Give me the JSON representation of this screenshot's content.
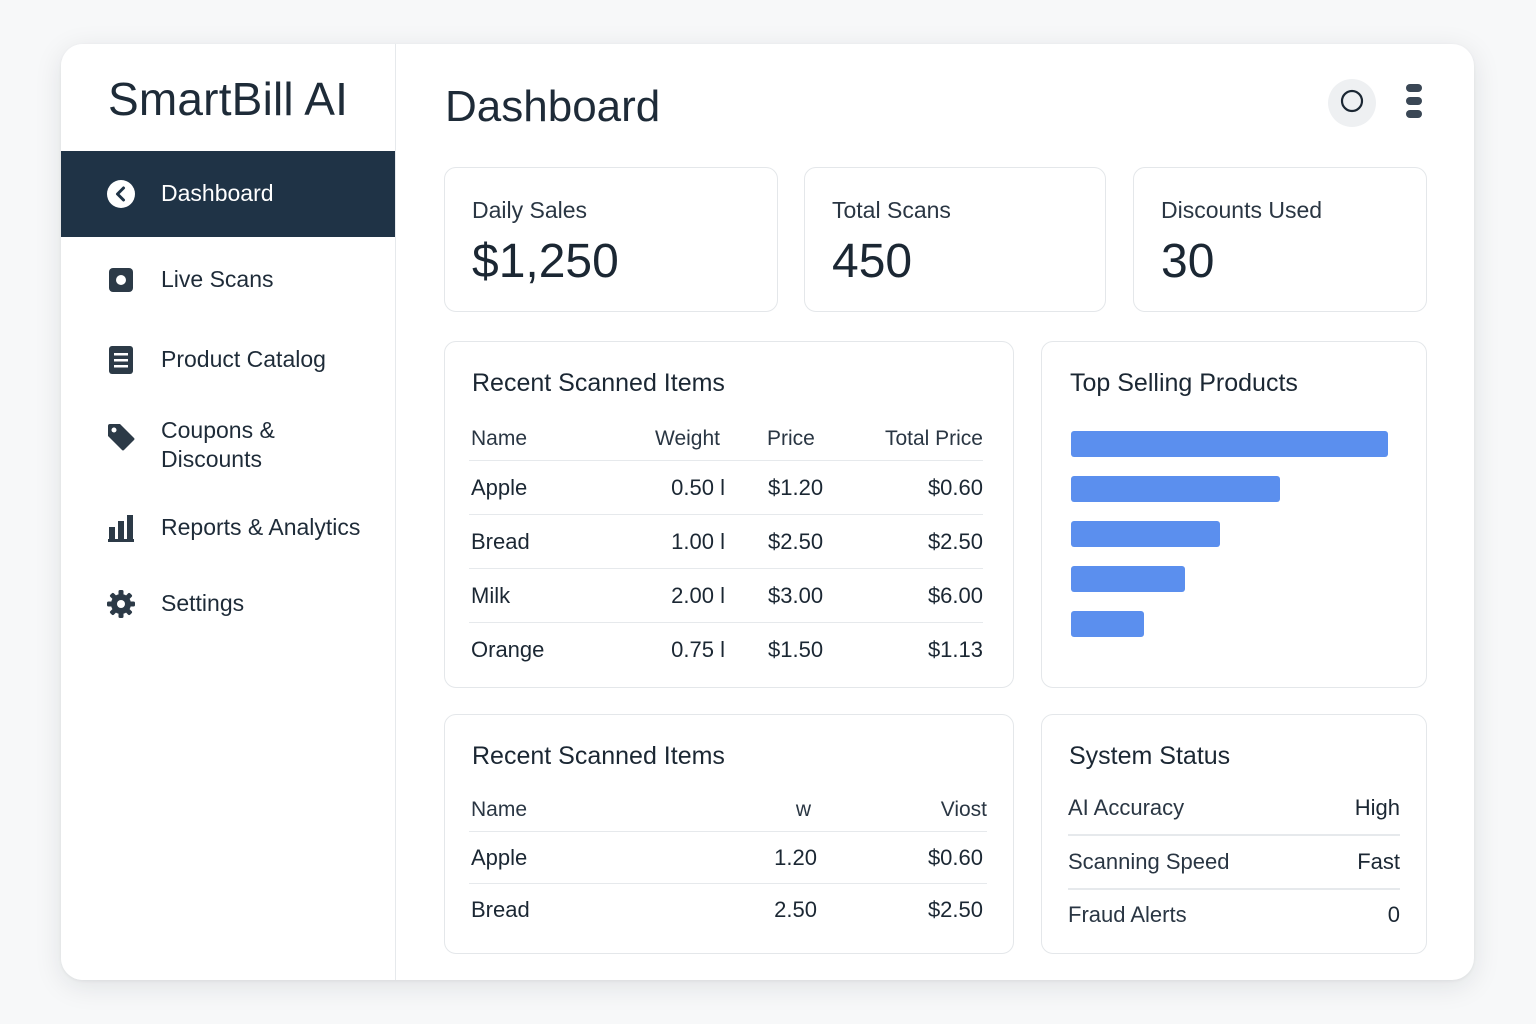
{
  "app": {
    "brand": "SmartBill AI"
  },
  "sidebar": {
    "items": [
      {
        "label": "Dashboard",
        "icon": "chevron-left-circle-icon",
        "active": true
      },
      {
        "label": "Live Scans",
        "icon": "scan-icon",
        "active": false
      },
      {
        "label": "Product Catalog",
        "icon": "document-list-icon",
        "active": false
      },
      {
        "label_line1": "Coupons &",
        "label_line2": "Discounts",
        "icon": "tag-icon",
        "active": false
      },
      {
        "label": "Reports & Analytics",
        "icon": "bar-chart-icon",
        "active": false
      },
      {
        "label": "Settings",
        "icon": "gear-icon",
        "active": false
      }
    ]
  },
  "header": {
    "title": "Dashboard",
    "icons": [
      "circle-icon",
      "menu-icon"
    ]
  },
  "stats": [
    {
      "label": "Daily Sales",
      "value": "$1,250"
    },
    {
      "label": "Total Scans",
      "value": "450"
    },
    {
      "label": "Discounts Used",
      "value": "30"
    }
  ],
  "recent_scans": {
    "title": "Recent Scanned Items",
    "columns": [
      "Name",
      "Weight",
      "Price",
      "Total Price"
    ],
    "rows": [
      [
        "Apple",
        "0.50 l",
        "$1.20",
        "$0.60"
      ],
      [
        "Bread",
        "1.00 l",
        "$2.50",
        "$2.50"
      ],
      [
        "Milk",
        "2.00 l",
        "$3.00",
        "$6.00"
      ],
      [
        "Orange",
        "0.75 l",
        "$1.50",
        "$1.13"
      ]
    ]
  },
  "top_selling": {
    "title": "Top Selling Products",
    "bar_color": "#5b8fee",
    "relative_values": [
      1.0,
      0.66,
      0.47,
      0.36,
      0.23
    ]
  },
  "recent_scans_2": {
    "title": "Recent Scanned Items",
    "columns": [
      "Name",
      "w",
      "Viost"
    ],
    "rows": [
      [
        "Apple",
        "1.20",
        "$0.60"
      ],
      [
        "Bread",
        "2.50",
        "$2.50"
      ]
    ]
  },
  "system_status": {
    "title": "System Status",
    "rows": [
      {
        "label": "AI Accuracy",
        "value": "High"
      },
      {
        "label": "Scanning Speed",
        "value": "Fast"
      },
      {
        "label": "Fraud Alerts",
        "value": "0"
      }
    ]
  },
  "colors": {
    "sidebar_active": "#1f3346",
    "accent_bar": "#5b8fee",
    "text": "#1b2733"
  }
}
